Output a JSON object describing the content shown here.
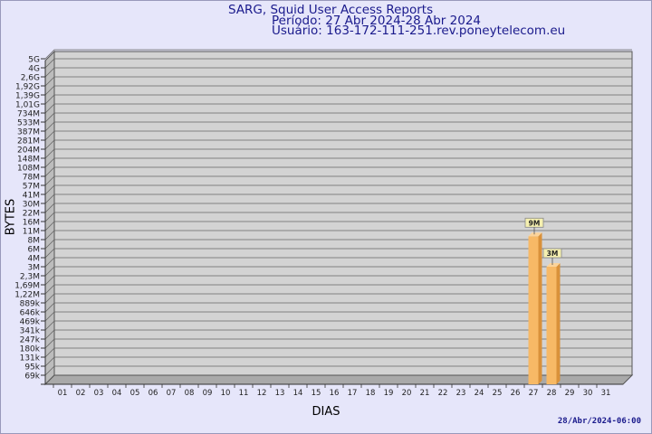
{
  "header": {
    "title": "SARG, Squid User Access Reports",
    "period": "Período: 27 Abr 2024-28 Abr 2024",
    "user": "Usuário: 163-172-111-251.rev.poneytelecom.eu"
  },
  "footer": {
    "timestamp": "28/Abr/2024-06:00"
  },
  "colors": {
    "background": "#e6e6fa",
    "plot": "#d3d3d3",
    "bar": "#f7b966",
    "bar_side": "#d9913a",
    "title": "#1a1a8c",
    "label_box": "#f5f0b0"
  },
  "chart_data": {
    "type": "bar",
    "xlabel": "DIAS",
    "ylabel": "BYTES",
    "y_scale": "log",
    "y_ticks": [
      "5G",
      "4G",
      "2,6G",
      "1,92G",
      "1,39G",
      "1,01G",
      "734M",
      "533M",
      "387M",
      "281M",
      "204M",
      "148M",
      "108M",
      "78M",
      "57M",
      "41M",
      "30M",
      "22M",
      "16M",
      "11M",
      "8M",
      "6M",
      "4M",
      "3M",
      "2,3M",
      "1,69M",
      "1,22M",
      "889k",
      "646k",
      "469k",
      "341k",
      "247k",
      "180k",
      "131k",
      "95k",
      "69k"
    ],
    "categories": [
      "01",
      "02",
      "03",
      "04",
      "05",
      "06",
      "07",
      "08",
      "09",
      "10",
      "11",
      "12",
      "13",
      "14",
      "15",
      "16",
      "17",
      "18",
      "19",
      "20",
      "21",
      "22",
      "23",
      "24",
      "25",
      "26",
      "27",
      "28",
      "29",
      "30",
      "31"
    ],
    "values": [
      0,
      0,
      0,
      0,
      0,
      0,
      0,
      0,
      0,
      0,
      0,
      0,
      0,
      0,
      0,
      0,
      0,
      0,
      0,
      0,
      0,
      0,
      0,
      0,
      0,
      0,
      9000000,
      3000000,
      0,
      0,
      0
    ],
    "data_labels": [
      "",
      "",
      "",
      "",
      "",
      "",
      "",
      "",
      "",
      "",
      "",
      "",
      "",
      "",
      "",
      "",
      "",
      "",
      "",
      "",
      "",
      "",
      "",
      "",
      "",
      "",
      "9M",
      "3M",
      "",
      "",
      ""
    ],
    "grid": true
  }
}
